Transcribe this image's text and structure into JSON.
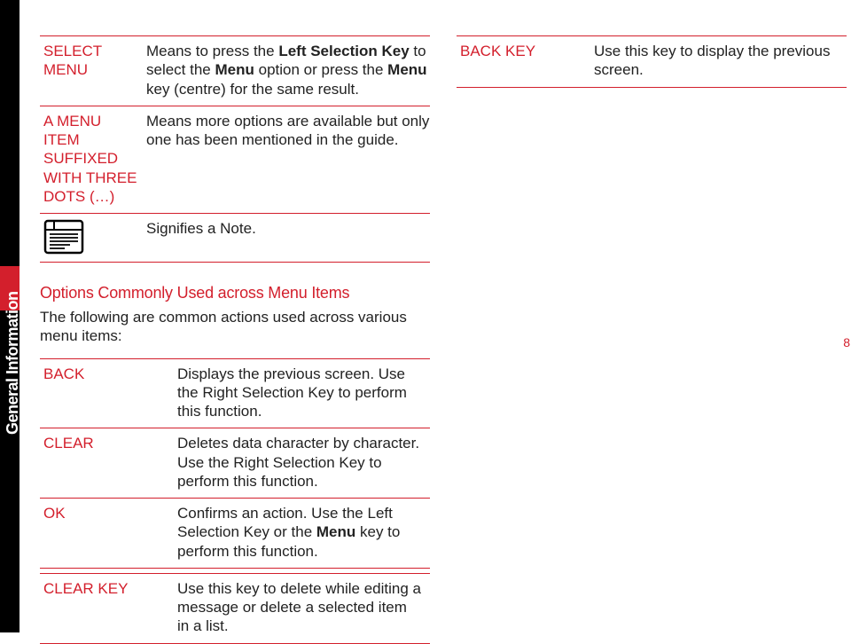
{
  "sidebar": {
    "label": "General Information"
  },
  "page_number": "8",
  "table1": {
    "rows": [
      {
        "term": "SELECT MENU",
        "desc_prefix": "Means to press the ",
        "desc_bold1": "Left Selection Key",
        "desc_mid1": " to select the ",
        "desc_bold2": "Menu",
        "desc_mid2": " option or press the ",
        "desc_bold3": "Menu",
        "desc_suffix": " key (centre) for the same result."
      },
      {
        "term": "A MENU ITEM SUFFIXED WITH THREE DOTS (…)",
        "desc": "Means more options are available but only one has been mentioned in the guide."
      },
      {
        "term_is_icon": true,
        "desc": "Signifies a Note."
      }
    ]
  },
  "subheading": "Options Commonly Used across Menu Items",
  "intro": "The following are common actions used across various menu items:",
  "table2": {
    "rows": [
      {
        "term": "BACK",
        "desc": "Displays the previous screen. Use the Right Selection Key to perform this function."
      },
      {
        "term": "CLEAR",
        "desc": "Deletes data character by character. Use the Right Selection Key to perform this function."
      },
      {
        "term": "OK",
        "desc_prefix": "Confirms an action. Use the Left Selection Key or the ",
        "desc_bold1": "Menu",
        "desc_suffix": " key to perform this function."
      },
      {
        "term": "CLEAR KEY",
        "desc": "Use this key to delete while editing a message or delete a selected item in a list."
      }
    ]
  },
  "table3": {
    "rows": [
      {
        "term": "BACK KEY",
        "desc": "Use this key to display the previous screen."
      }
    ]
  }
}
